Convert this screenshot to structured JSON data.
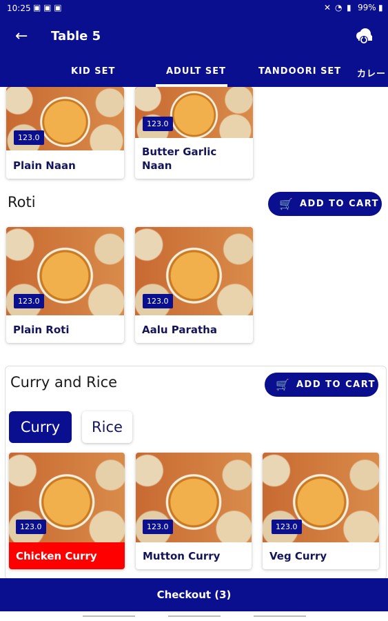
{
  "status": {
    "time": "10:25",
    "battery": "99%"
  },
  "appbar": {
    "title": "Table 5"
  },
  "tabs": [
    "KID SET",
    "ADULT SET",
    "TANDOORI SET",
    "カレー"
  ],
  "naan": {
    "items": [
      {
        "price": "123.0",
        "name": "Plain Naan"
      },
      {
        "price": "123.0",
        "name": "Butter Garlic Naan"
      }
    ]
  },
  "roti": {
    "title": "Roti",
    "add_to_cart": "ADD TO CART",
    "items": [
      {
        "price": "123.0",
        "name": "Plain Roti"
      },
      {
        "price": "123.0",
        "name": "Aalu Paratha"
      }
    ]
  },
  "curry_rice": {
    "title": "Curry and Rice",
    "add_to_cart": "ADD TO CART",
    "filters": [
      "Curry",
      "Rice"
    ],
    "items": [
      {
        "price": "123.0",
        "name": "Chicken Curry"
      },
      {
        "price": "123.0",
        "name": "Mutton Curry"
      },
      {
        "price": "123.0",
        "name": "Veg Curry"
      }
    ]
  },
  "checkout": {
    "label": "Checkout (3)"
  },
  "colors": {
    "primary": "#0a0f8f",
    "selected_item": "#ff0000",
    "accent_text": "#14145a"
  }
}
